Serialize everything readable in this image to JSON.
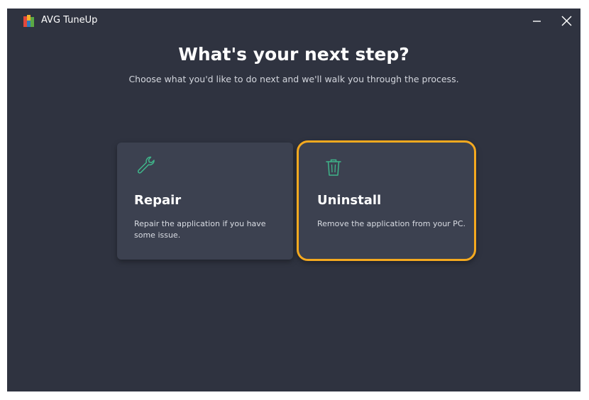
{
  "window": {
    "title": "AVG TuneUp",
    "minimize_icon": "minimize-icon",
    "close_icon": "close-icon"
  },
  "main": {
    "heading": "What's your next step?",
    "subheading": "Choose what you'd like to do next and we'll walk you through the process."
  },
  "options": [
    {
      "icon": "wrench-icon",
      "title": "Repair",
      "description": "Repair the application if you have some issue.",
      "selected": false
    },
    {
      "icon": "trash-icon",
      "title": "Uninstall",
      "description": "Remove the application from your PC.",
      "selected": true
    }
  ],
  "colors": {
    "background": "#2f3340",
    "card": "#3c4150",
    "selected_border": "#f4a91f",
    "icon_accent": "#3fb58a"
  }
}
